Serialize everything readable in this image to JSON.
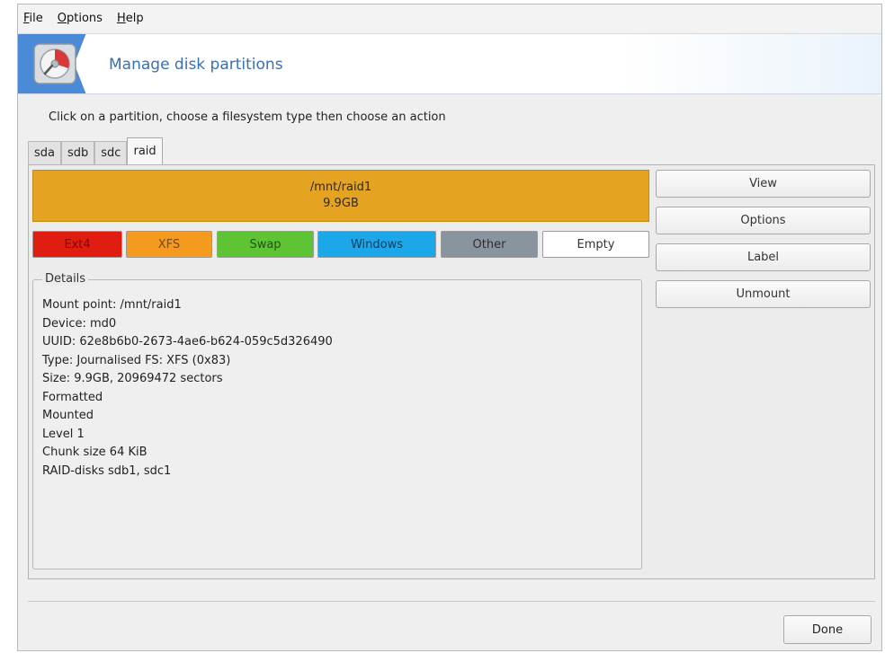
{
  "menubar": {
    "items": [
      {
        "label": "File",
        "mnemonic": "F",
        "rest": "ile"
      },
      {
        "label": "Options",
        "mnemonic": "O",
        "rest": "ptions"
      },
      {
        "label": "Help",
        "mnemonic": "H",
        "rest": "elp"
      }
    ]
  },
  "banner": {
    "title": "Manage disk partitions",
    "icon": "disk-partition-icon"
  },
  "instruction": "Click on a partition, choose a filesystem type then choose an action",
  "tabs": [
    "sda",
    "sdb",
    "sdc",
    "raid"
  ],
  "active_tab": "raid",
  "partition": {
    "mount": "/mnt/raid1",
    "size": "9.9GB",
    "color": "#e5a322"
  },
  "legend": [
    {
      "label": "Ext4",
      "color": "#e11d12"
    },
    {
      "label": "XFS",
      "color": "#f39a1f"
    },
    {
      "label": "Swap",
      "color": "#5fc433"
    },
    {
      "label": "Windows",
      "color": "#1ba7e8"
    },
    {
      "label": "Other",
      "color": "#8a949e"
    },
    {
      "label": "Empty",
      "color": "#ffffff"
    }
  ],
  "details": {
    "legend": "Details",
    "lines": [
      "Mount point: /mnt/raid1",
      "Device: md0",
      "UUID: 62e8b6b0-2673-4ae6-b624-059c5d326490",
      "Type: Journalised FS: XFS (0x83)",
      "Size: 9.9GB, 20969472 sectors",
      "Formatted",
      "Mounted",
      "Level 1",
      "Chunk size 64 KiB",
      "RAID-disks sdb1, sdc1"
    ]
  },
  "actions": [
    "View",
    "Options",
    "Label",
    "Unmount"
  ],
  "done_label": "Done"
}
